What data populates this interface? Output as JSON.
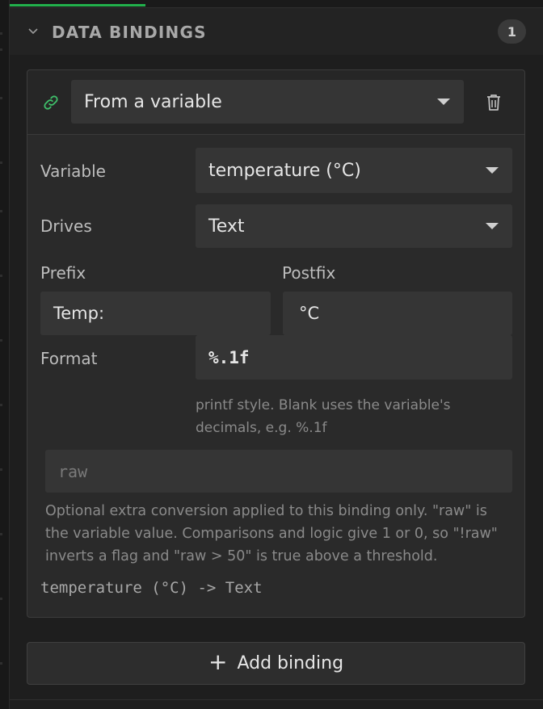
{
  "progress": {
    "value_percent": 25.5,
    "color": "#22b14c"
  },
  "section": {
    "title": "DATA BINDINGS",
    "count": "1"
  },
  "binding": {
    "source_select": "From a variable",
    "variable": {
      "label": "Variable",
      "value": "temperature (°C)"
    },
    "drives": {
      "label": "Drives",
      "value": "Text"
    },
    "prefix": {
      "label": "Prefix",
      "value": "Temp:"
    },
    "postfix": {
      "label": "Postfix",
      "value": "°C"
    },
    "format": {
      "label": "Format",
      "value": "%.1f",
      "hint_line1": "printf style. Blank uses the variable's",
      "hint_line2": "decimals, e.g. %.1f"
    },
    "expression": {
      "placeholder": "raw",
      "hint_line1": "Optional extra conversion applied to this binding only. \"raw\" is",
      "hint_line2": "the variable value. Comparisons and logic give 1 or 0, so \"!raw\"",
      "hint_line3": "inverts a flag and \"raw > 50\" is true above a threshold."
    },
    "summary": "temperature (°C) -> Text"
  },
  "add_button": {
    "label": "Add binding",
    "icon": "plus-icon"
  },
  "icons": {
    "collapse": "chevron-down-icon",
    "link": "link-icon",
    "delete": "trash-icon"
  },
  "colors": {
    "accent_green": "#22b14c",
    "link_icon": "#3fbf6a"
  }
}
